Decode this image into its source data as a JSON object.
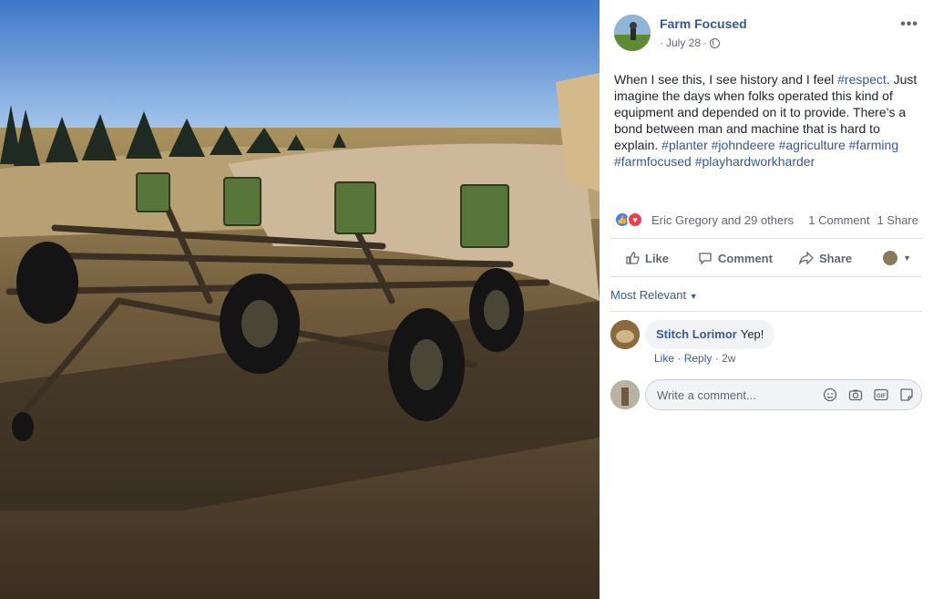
{
  "photo": {
    "description_icon": "planter-photo"
  },
  "post": {
    "page_name": "Farm Focused",
    "date": "July 28",
    "separator": "·",
    "more_icon": "more-options-icon",
    "text_plain_1": "When I see this, I see history and I feel ",
    "hashtag_respect": "#respect",
    "text_plain_2": ". Just imagine the days when folks operated this kind of equipment and depended on it to provide. There’s a bond between man and machine that is hard to explain. ",
    "hashtags": [
      "#planter",
      "#johndeere",
      "#agriculture",
      "#farming",
      "#farmfocused",
      "#playhardworkharder"
    ]
  },
  "reactions": {
    "names": "Eric Gregory and 29 others",
    "comments_count": "1 Comment",
    "shares_count": "1 Share",
    "like_color": "#4b7cf3",
    "love_color": "#ef3e4a"
  },
  "actions": {
    "like_label": "Like",
    "comment_label": "Comment",
    "share_label": "Share"
  },
  "comments": {
    "sort_label": "Most Relevant",
    "items": [
      {
        "author": "Stitch Lorimor",
        "text": "Yep!",
        "like_label": "Like",
        "reply_label": "Reply",
        "age": "2w"
      }
    ],
    "write_placeholder": "Write a comment..."
  },
  "colors": {
    "link": "#365899",
    "muted": "#616770"
  }
}
